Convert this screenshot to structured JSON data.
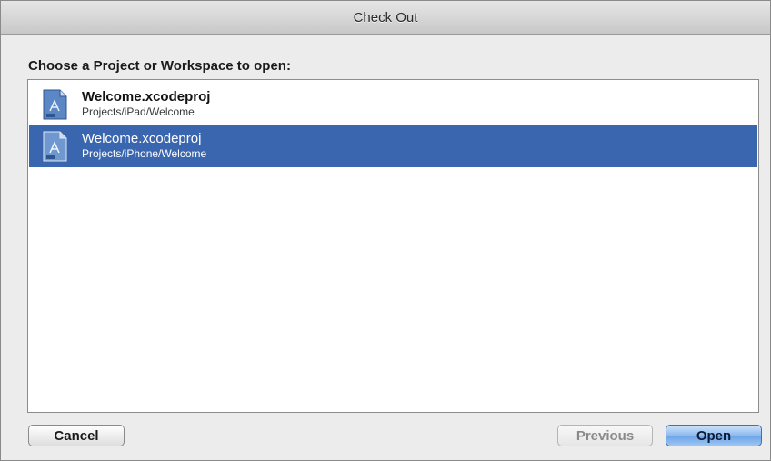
{
  "window": {
    "title": "Check Out"
  },
  "dialog": {
    "prompt": "Choose a Project or Workspace to open:",
    "items": [
      {
        "name": "Welcome.xcodeproj",
        "path": "Projects/iPad/Welcome",
        "icon": "xcodeproj-file-icon",
        "selected": false
      },
      {
        "name": "Welcome.xcodeproj",
        "path": "Projects/iPhone/Welcome",
        "icon": "xcodeproj-file-icon",
        "selected": true
      }
    ]
  },
  "buttons": {
    "cancel": "Cancel",
    "previous": "Previous",
    "open": "Open"
  },
  "colors": {
    "selection": "#3a66b0",
    "default_button": "#6aa3e6"
  }
}
